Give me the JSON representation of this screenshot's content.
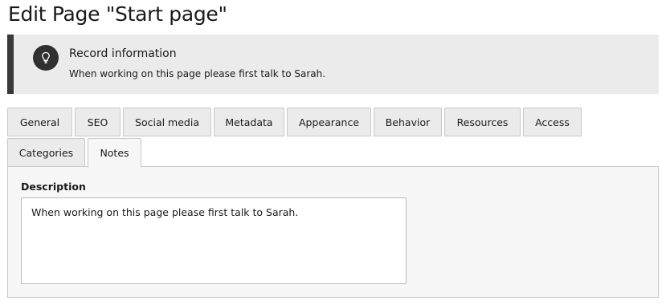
{
  "page": {
    "title": "Edit Page \"Start page\""
  },
  "callout": {
    "title": "Record information",
    "message": "When working on this page please first talk to Sarah.",
    "icon": "lightbulb-icon"
  },
  "tabs": {
    "row1": [
      {
        "label": "General"
      },
      {
        "label": "SEO"
      },
      {
        "label": "Social media"
      },
      {
        "label": "Metadata"
      },
      {
        "label": "Appearance"
      },
      {
        "label": "Behavior"
      },
      {
        "label": "Resources"
      },
      {
        "label": "Access"
      }
    ],
    "row2": [
      {
        "label": "Categories"
      },
      {
        "label": "Notes",
        "active": true
      }
    ]
  },
  "form": {
    "description_label": "Description",
    "description_value": "When working on this page please first talk to Sarah."
  }
}
